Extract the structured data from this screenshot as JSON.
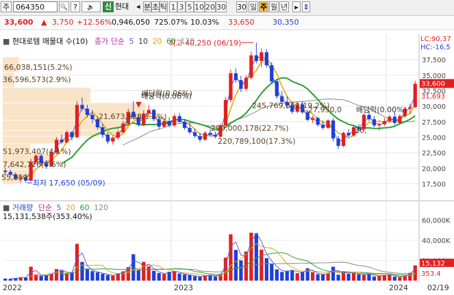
{
  "toolbar": {
    "market": "주",
    "code": "064350",
    "search_glyph": "🔍",
    "ask_glyph": "?",
    "sound_glyph": "🔈",
    "new_badge": "신",
    "name": "현대",
    "prev_glyph": "◂",
    "tick_label": "분",
    "tick_label2": "초",
    "tick_label3": "틱",
    "periods": [
      "1",
      "3",
      "5",
      "10",
      "20",
      "30"
    ],
    "count": "30",
    "views": [
      "일",
      "주",
      "월",
      "년"
    ],
    "selected_view": "주",
    "end_glyph": "▸"
  },
  "price": {
    "current": "33,600",
    "change_arrow": "▲",
    "change": "3,750",
    "change_pct": "+12.56%",
    "volume": "0,946,050",
    "volume_ratio": "725.07%",
    "turnover": "10.03%",
    "high": "33,650",
    "low": "30,350"
  },
  "colors": {
    "up": "#e02020",
    "down": "#1f3fd8",
    "ma5": "#5b5bd6",
    "ma20": "#e0a800",
    "ma60": "#22a032",
    "ma120": "#888888"
  },
  "legend": {
    "title": "현대로템 매물대 수(10)",
    "indicator": "종가 단순",
    "ma": [
      "5",
      "10",
      "20",
      "60",
      "120"
    ],
    "lc": "LC:90,37",
    "hc": "HC:-16,5"
  },
  "price_axis": [
    "37,500",
    "35,000",
    "32,500",
    "30,000",
    "27,500",
    "25,000",
    "22,500",
    "20,000",
    "17,500"
  ],
  "price_tags": {
    "last": "33,600",
    "prev": "31,693"
  },
  "volume_profile": [
    "66,038,151(5.2%)",
    "36,596,573(2.9%)",
    "배당락(0.06%)",
    "21,673,628(1.7%)",
    "290,000,178(22.7%)",
    "220,789,100(17.3%)",
    "245,769,862(19.2%)",
    "27,950,0",
    "26,",
    "51,973,407(4.1%)",
    "7,642,726(0.6%)",
    "55,859,"
  ],
  "annotations": {
    "high": "최고 40,250 (06/19)",
    "low": "최저 17,650 (05/09)",
    "div1": "배당락(0.06%)",
    "div2": "배당락(0.00%)",
    "div_marker": "▼"
  },
  "volume_panel": {
    "title": "거래량",
    "indicator": "단순",
    "ma": [
      "5",
      "20",
      "60",
      "120"
    ],
    "info": "15,131,538주(353.40%)",
    "axis": [
      "60,000K",
      "40,000K",
      "20,000K"
    ],
    "tag_current": "15,132",
    "tag_ratio": "353.4"
  },
  "x_axis": [
    "2022",
    "2023",
    "2024",
    "02/19"
  ],
  "chart_data": {
    "type": "candlestick",
    "period": "weekly",
    "ylim": [
      16000,
      40500
    ],
    "ohlc": [
      [
        19600,
        20100,
        18900,
        19400
      ],
      [
        19400,
        19800,
        18600,
        19000
      ],
      [
        19000,
        19300,
        18100,
        18300
      ],
      [
        18300,
        18800,
        17700,
        18500
      ],
      [
        18500,
        19000,
        17650,
        18000
      ],
      [
        18000,
        21500,
        17900,
        21000
      ],
      [
        21000,
        22300,
        20700,
        22000
      ],
      [
        22000,
        22400,
        20400,
        20800
      ],
      [
        20800,
        21300,
        19900,
        20300
      ],
      [
        20300,
        22800,
        20200,
        22500
      ],
      [
        22500,
        25000,
        22300,
        24600
      ],
      [
        24600,
        25400,
        23900,
        24200
      ],
      [
        24200,
        26100,
        24000,
        25800
      ],
      [
        25800,
        26000,
        24500,
        25000
      ],
      [
        25000,
        30800,
        24900,
        30200
      ],
      [
        30200,
        31400,
        29200,
        29600
      ],
      [
        29600,
        30200,
        28200,
        28600
      ],
      [
        28600,
        29400,
        27300,
        27900
      ],
      [
        27900,
        28400,
        26200,
        26600
      ],
      [
        26600,
        27200,
        24900,
        25400
      ],
      [
        25400,
        25800,
        23900,
        24300
      ],
      [
        24300,
        25200,
        23800,
        24900
      ],
      [
        24900,
        26200,
        24600,
        25800
      ],
      [
        25800,
        27600,
        25600,
        27200
      ],
      [
        27200,
        29600,
        27000,
        29100
      ],
      [
        29100,
        30800,
        28600,
        28200
      ],
      [
        28200,
        28600,
        26700,
        27000
      ],
      [
        27000,
        29300,
        26800,
        28800
      ],
      [
        28800,
        30200,
        28400,
        29400
      ],
      [
        29400,
        29600,
        27600,
        27900
      ],
      [
        27900,
        28300,
        26300,
        26700
      ],
      [
        26700,
        28000,
        26500,
        27600
      ],
      [
        27600,
        28200,
        26600,
        26900
      ],
      [
        26900,
        28800,
        26700,
        28400
      ],
      [
        28400,
        28900,
        27200,
        27500
      ],
      [
        27500,
        27900,
        26200,
        26500
      ],
      [
        26500,
        27300,
        25500,
        25800
      ],
      [
        25800,
        26400,
        24900,
        25200
      ],
      [
        25200,
        25700,
        24200,
        24600
      ],
      [
        24600,
        26000,
        24400,
        25700
      ],
      [
        25700,
        26300,
        25100,
        25400
      ],
      [
        25400,
        25900,
        24800,
        25100
      ],
      [
        25100,
        27200,
        24900,
        26900
      ],
      [
        26900,
        31500,
        26800,
        31000
      ],
      [
        31000,
        35900,
        30600,
        35300
      ],
      [
        35300,
        36100,
        33800,
        34200
      ],
      [
        34200,
        34900,
        32300,
        32800
      ],
      [
        32800,
        35000,
        32500,
        34600
      ],
      [
        34600,
        38800,
        34300,
        38200
      ],
      [
        38200,
        40250,
        36900,
        37300
      ],
      [
        37300,
        39300,
        36300,
        38700
      ],
      [
        38700,
        39200,
        36200,
        36600
      ],
      [
        36600,
        37100,
        33600,
        34000
      ],
      [
        34000,
        34400,
        31200,
        31600
      ],
      [
        31600,
        32400,
        30300,
        30700
      ],
      [
        30700,
        31600,
        29600,
        30100
      ],
      [
        30100,
        30800,
        28800,
        29100
      ],
      [
        29100,
        30600,
        28900,
        30300
      ],
      [
        30300,
        30800,
        28800,
        29000
      ],
      [
        29000,
        29400,
        27600,
        27800
      ],
      [
        27800,
        28500,
        27300,
        28100
      ],
      [
        28100,
        28300,
        26700,
        27000
      ],
      [
        27000,
        27700,
        26200,
        26500
      ],
      [
        26500,
        27900,
        26300,
        27700
      ],
      [
        27700,
        28100,
        24300,
        24800
      ],
      [
        24800,
        25200,
        23100,
        23600
      ],
      [
        23600,
        25900,
        23400,
        25700
      ],
      [
        25700,
        26300,
        25000,
        25300
      ],
      [
        25300,
        26900,
        25100,
        26600
      ],
      [
        26600,
        27100,
        25900,
        26300
      ],
      [
        26300,
        28900,
        26100,
        28600
      ],
      [
        28600,
        29300,
        27600,
        27900
      ],
      [
        27900,
        28400,
        26600,
        26900
      ],
      [
        26900,
        27400,
        26100,
        27100
      ],
      [
        27100,
        28100,
        26800,
        27600
      ],
      [
        27600,
        28600,
        27400,
        28300
      ],
      [
        28300,
        29100,
        27000,
        27300
      ],
      [
        27300,
        28700,
        27100,
        28400
      ],
      [
        28400,
        29800,
        28200,
        29600
      ],
      [
        29600,
        30400,
        28700,
        29850
      ],
      [
        29850,
        34100,
        29700,
        33600
      ]
    ],
    "volume_k": [
      2000,
      1800,
      2500,
      3400,
      3100,
      13800,
      6200,
      4800,
      5200,
      7100,
      11500,
      9800,
      7200,
      8400,
      36500,
      18600,
      11200,
      9400,
      8200,
      6800,
      5600,
      4900,
      7400,
      9200,
      13400,
      26200,
      10400,
      18700,
      14100,
      9800,
      7600,
      6700,
      8800,
      9600,
      7100,
      6000,
      5400,
      4300,
      3800,
      5200,
      5700,
      4200,
      6600,
      22800,
      46000,
      30500,
      20100,
      28900,
      47600,
      46900,
      30800,
      22300,
      16800,
      11200,
      8600,
      9900,
      10600,
      7400,
      8800,
      12200,
      8500,
      6400,
      6100,
      7200,
      13800,
      5900,
      9300,
      7000,
      7800,
      6400,
      5700,
      7100,
      4100,
      4900,
      5300,
      6200,
      4000,
      3300,
      5100,
      7800,
      15132
    ]
  }
}
